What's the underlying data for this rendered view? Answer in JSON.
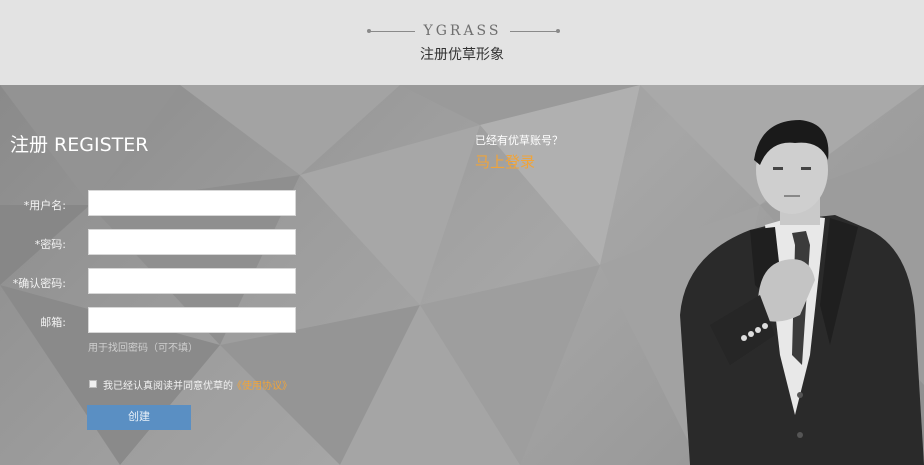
{
  "header": {
    "brand": "YGRASS",
    "tagline": "注册优草形象"
  },
  "register": {
    "title": "注册 REGISTER",
    "fields": [
      {
        "label": "*用户名:",
        "value": ""
      },
      {
        "label": "*密码:",
        "value": ""
      },
      {
        "label": "*确认密码:",
        "value": ""
      },
      {
        "label": "邮箱:",
        "value": ""
      }
    ],
    "email_hint": "用于找回密码（可不填）",
    "agree_text": "我已经认真阅读并同意优草的",
    "agree_link": "《使用协议》",
    "agree_checked": false,
    "submit_label": "创建"
  },
  "login_prompt": {
    "question": "已经有优草账号？",
    "link": "马上登录"
  },
  "colors": {
    "accent": "#f0a43a",
    "button": "#5a8fc3",
    "header_bg": "#e3e3e3"
  }
}
